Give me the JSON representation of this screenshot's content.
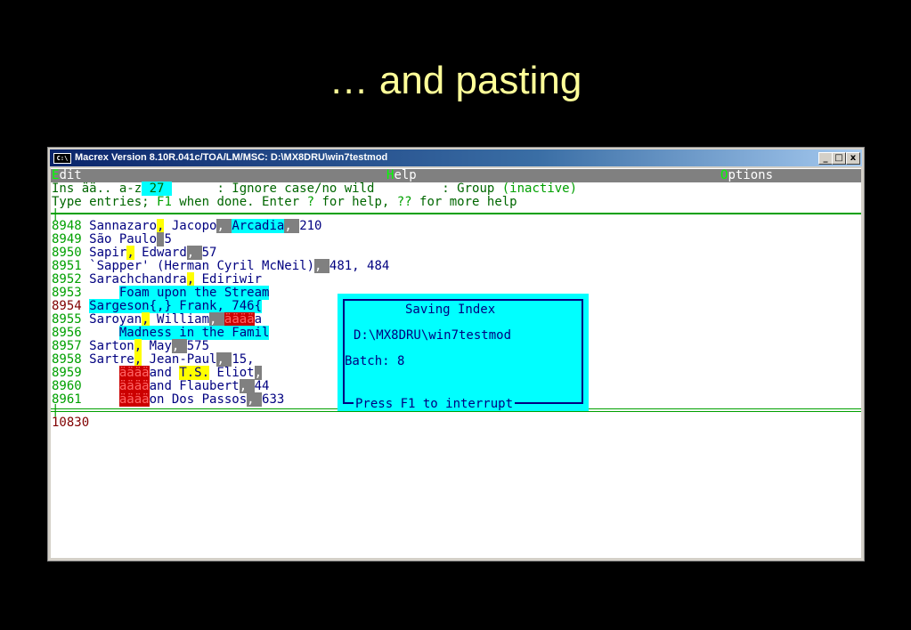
{
  "slide": {
    "title": "… and pasting"
  },
  "window": {
    "title": "Macrex Version 8.10R.041c/TOA/LM/MSC: D:\\MX8DRU\\win7testmod",
    "icon_label": "C:\\",
    "minimize": "_",
    "maximize": "□",
    "close": "x"
  },
  "menu": [
    {
      "hotkey": "E",
      "rest": "dit"
    },
    {
      "hotkey": "H",
      "rest": "elp"
    },
    {
      "hotkey": "O",
      "rest": "ptions"
    }
  ],
  "status": {
    "ins_label": "Ins ää.. a-z",
    "count": " 27 ",
    "ignore": "      : Ignore case/no wild",
    "group": "         : Group ",
    "group_state": "(inactive)",
    "help_a": "Type entries; ",
    "f1": "F1",
    "help_b": " when done. Enter ",
    "q1": "?",
    "help_c": " for help, ",
    "q2": "??",
    "help_d": " for more help",
    "cursor": "|"
  },
  "entries": [
    {
      "num": "8948",
      "parts": [
        "Sannazaro",
        ",",
        " Jacopo",
        ", ",
        "Arcadia",
        ", ",
        "210"
      ]
    },
    {
      "num": "8949",
      "parts": [
        "São Paulo",
        " ",
        "5"
      ]
    },
    {
      "num": "8950",
      "parts": [
        "Sapir",
        ",",
        " Edward",
        ", ",
        "57"
      ]
    },
    {
      "num": "8951",
      "parts": [
        "`Sapper' (Herman Cyril McNeil)",
        ", ",
        "481, 484"
      ]
    },
    {
      "num": "8952",
      "parts": [
        "Sarachchandra",
        ",",
        " Ediriwir"
      ]
    },
    {
      "num": "8953",
      "parts": [
        "    ",
        "Foam upon the Stream"
      ]
    },
    {
      "num": "8954",
      "parts": [
        "Sargeson{,} Frank, 746{"
      ]
    },
    {
      "num": "8955",
      "parts": [
        "Saroyan",
        ",",
        " William",
        ", ",
        "ääää",
        "a"
      ]
    },
    {
      "num": "8956",
      "parts": [
        "    ",
        "Madness in the Famil"
      ]
    },
    {
      "num": "8957",
      "parts": [
        "Sarton",
        ",",
        " May",
        ", ",
        "575"
      ]
    },
    {
      "num": "8958",
      "parts": [
        "Sartre",
        ",",
        " Jean-Paul",
        ", ",
        "15,"
      ]
    },
    {
      "num": "8959",
      "parts": [
        "    ",
        "ääää",
        "and ",
        "T.S.",
        " Eliot",
        ","
      ]
    },
    {
      "num": "8960",
      "parts": [
        "    ",
        "ääää",
        "and Flaubert",
        ", ",
        "44"
      ]
    },
    {
      "num": "8961",
      "parts": [
        "    ",
        "ääää",
        "on Dos Passos",
        ", ",
        "633"
      ]
    }
  ],
  "lower": {
    "cursor": "|",
    "record": "10830"
  },
  "dialog": {
    "title": "Saving Index",
    "path": "D:\\MX8DRU\\win7testmod",
    "batch": "Batch: 8",
    "interrupt": "Press F1 to interrupt"
  }
}
